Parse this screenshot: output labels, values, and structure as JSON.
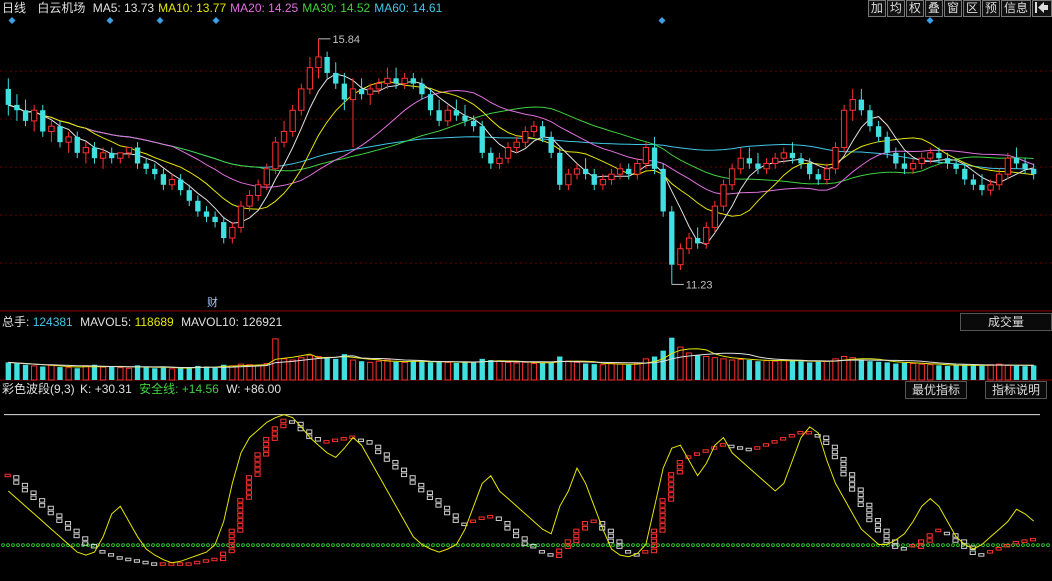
{
  "header": {
    "period": "日线",
    "stock_name": "白云机场",
    "ma": [
      {
        "label": "MA5:",
        "value": "13.73",
        "color": "#e0e0e0"
      },
      {
        "label": "MA10:",
        "value": "13.77",
        "color": "#e6e600"
      },
      {
        "label": "MA20:",
        "value": "14.25",
        "color": "#e070e0"
      },
      {
        "label": "MA30:",
        "value": "14.52",
        "color": "#40d040"
      },
      {
        "label": "MA60:",
        "value": "14.61",
        "color": "#40c8e8"
      }
    ]
  },
  "toolbar": {
    "buttons": [
      "加",
      "均",
      "权",
      "叠",
      "窗",
      "区",
      "预",
      "信息"
    ],
    "pin_icon": "pin-icon"
  },
  "price_panel": {
    "high_label": "15.84",
    "low_label": "11.23",
    "event_marker": "财"
  },
  "volume_panel": {
    "title": "总手:",
    "total": "124381",
    "mavol5_label": "MAVOL5:",
    "mavol5": "118689",
    "mavol10_label": "MAVOL10:",
    "mavol10": "126921",
    "dropdown_label": "成交量"
  },
  "indicator_panel": {
    "name": "彩色波段(9,3)",
    "k_label": "K:",
    "k_value": "+30.31",
    "safe_label": "安全线:",
    "safe_value": "+14.56",
    "w_label": "W:",
    "w_value": "+86.00",
    "best_button": "最优指标",
    "explain_button": "指标说明"
  },
  "colors": {
    "up": "#ff3030",
    "down": "#40e0e0",
    "ma5": "#e0e0e0",
    "ma10": "#e6e600",
    "ma20": "#e070e0",
    "ma30": "#40d040",
    "ma60": "#40c8e8",
    "grid": "#6a0000"
  },
  "chart_data": {
    "type": "line",
    "price_range": [
      10.9,
      16.1
    ],
    "candles": [
      [
        14.9,
        15.1,
        14.4,
        14.6
      ],
      [
        14.6,
        14.8,
        14.3,
        14.5
      ],
      [
        14.5,
        14.7,
        14.2,
        14.3
      ],
      [
        14.3,
        14.6,
        14.1,
        14.5
      ],
      [
        14.5,
        14.6,
        14.0,
        14.1
      ],
      [
        14.1,
        14.3,
        13.9,
        14.2
      ],
      [
        14.2,
        14.3,
        13.8,
        13.9
      ],
      [
        13.9,
        14.1,
        13.7,
        14.0
      ],
      [
        14.0,
        14.1,
        13.6,
        13.7
      ],
      [
        13.7,
        13.9,
        13.5,
        13.8
      ],
      [
        13.8,
        13.9,
        13.5,
        13.6
      ],
      [
        13.6,
        13.8,
        13.4,
        13.7
      ],
      [
        13.7,
        13.8,
        13.5,
        13.6
      ],
      [
        13.6,
        13.7,
        13.5,
        13.7
      ],
      [
        13.7,
        13.8,
        13.6,
        13.8
      ],
      [
        13.8,
        13.9,
        13.4,
        13.5
      ],
      [
        13.5,
        13.6,
        13.3,
        13.4
      ],
      [
        13.4,
        13.5,
        13.2,
        13.3
      ],
      [
        13.3,
        13.4,
        13.0,
        13.1
      ],
      [
        13.1,
        13.3,
        13.0,
        13.2
      ],
      [
        13.2,
        13.3,
        12.9,
        13.0
      ],
      [
        13.0,
        13.1,
        12.7,
        12.8
      ],
      [
        12.8,
        12.9,
        12.5,
        12.6
      ],
      [
        12.6,
        12.7,
        12.4,
        12.5
      ],
      [
        12.5,
        12.6,
        12.3,
        12.4
      ],
      [
        12.4,
        12.5,
        12.0,
        12.1
      ],
      [
        12.1,
        12.4,
        12.0,
        12.3
      ],
      [
        12.3,
        12.8,
        12.2,
        12.7
      ],
      [
        12.7,
        13.0,
        12.6,
        12.9
      ],
      [
        12.9,
        13.2,
        12.8,
        13.1
      ],
      [
        13.1,
        13.5,
        13.0,
        13.4
      ],
      [
        13.4,
        14.0,
        13.3,
        13.9
      ],
      [
        13.9,
        14.3,
        13.8,
        14.1
      ],
      [
        14.1,
        14.6,
        14.0,
        14.5
      ],
      [
        14.5,
        15.0,
        14.4,
        14.9
      ],
      [
        14.9,
        15.5,
        14.8,
        15.3
      ],
      [
        15.3,
        15.84,
        15.1,
        15.5
      ],
      [
        15.5,
        15.6,
        15.1,
        15.2
      ],
      [
        15.2,
        15.4,
        14.9,
        15.0
      ],
      [
        15.0,
        15.2,
        14.5,
        14.7
      ],
      [
        14.7,
        15.1,
        13.8,
        14.9
      ],
      [
        14.9,
        15.1,
        14.7,
        14.8
      ],
      [
        14.8,
        15.0,
        14.6,
        14.9
      ],
      [
        14.9,
        15.1,
        14.8,
        15.0
      ],
      [
        15.0,
        15.3,
        14.9,
        15.1
      ],
      [
        15.1,
        15.3,
        14.9,
        15.0
      ],
      [
        15.0,
        15.2,
        14.9,
        15.1
      ],
      [
        15.1,
        15.2,
        14.9,
        15.0
      ],
      [
        15.0,
        15.1,
        14.7,
        14.8
      ],
      [
        14.8,
        14.9,
        14.4,
        14.5
      ],
      [
        14.5,
        14.7,
        14.2,
        14.3
      ],
      [
        14.3,
        14.6,
        14.2,
        14.5
      ],
      [
        14.5,
        14.7,
        14.3,
        14.4
      ],
      [
        14.4,
        14.6,
        14.2,
        14.3
      ],
      [
        14.3,
        14.4,
        14.1,
        14.2
      ],
      [
        14.2,
        14.3,
        13.6,
        13.7
      ],
      [
        13.7,
        13.8,
        13.4,
        13.5
      ],
      [
        13.5,
        13.7,
        13.4,
        13.6
      ],
      [
        13.6,
        13.9,
        13.5,
        13.8
      ],
      [
        13.8,
        14.0,
        13.7,
        13.9
      ],
      [
        13.9,
        14.2,
        13.8,
        14.1
      ],
      [
        14.1,
        14.3,
        14.0,
        14.2
      ],
      [
        14.2,
        14.3,
        13.9,
        14.0
      ],
      [
        14.0,
        14.1,
        13.6,
        13.7
      ],
      [
        13.7,
        13.8,
        13.0,
        13.1
      ],
      [
        13.1,
        13.4,
        13.0,
        13.3
      ],
      [
        13.3,
        13.5,
        13.2,
        13.4
      ],
      [
        13.4,
        13.6,
        13.2,
        13.3
      ],
      [
        13.3,
        13.4,
        13.0,
        13.1
      ],
      [
        13.1,
        13.3,
        13.0,
        13.2
      ],
      [
        13.2,
        13.4,
        13.1,
        13.3
      ],
      [
        13.3,
        13.5,
        13.2,
        13.4
      ],
      [
        13.4,
        13.5,
        13.2,
        13.3
      ],
      [
        13.3,
        13.6,
        13.2,
        13.5
      ],
      [
        13.5,
        13.9,
        13.4,
        13.8
      ],
      [
        13.8,
        14.0,
        13.3,
        13.4
      ],
      [
        13.4,
        13.5,
        12.5,
        12.6
      ],
      [
        12.6,
        12.7,
        11.23,
        11.6
      ],
      [
        11.6,
        12.0,
        11.5,
        11.9
      ],
      [
        11.9,
        12.2,
        11.8,
        12.1
      ],
      [
        12.1,
        12.3,
        11.9,
        12.0
      ],
      [
        12.0,
        12.4,
        11.9,
        12.3
      ],
      [
        12.3,
        12.8,
        12.2,
        12.7
      ],
      [
        12.7,
        13.2,
        12.6,
        13.1
      ],
      [
        13.1,
        13.5,
        13.0,
        13.4
      ],
      [
        13.4,
        13.8,
        13.3,
        13.6
      ],
      [
        13.6,
        13.8,
        13.4,
        13.5
      ],
      [
        13.5,
        13.7,
        13.3,
        13.4
      ],
      [
        13.4,
        13.6,
        13.3,
        13.5
      ],
      [
        13.5,
        13.7,
        13.4,
        13.6
      ],
      [
        13.6,
        13.8,
        13.5,
        13.7
      ],
      [
        13.7,
        13.9,
        13.5,
        13.6
      ],
      [
        13.6,
        13.7,
        13.4,
        13.5
      ],
      [
        13.5,
        13.6,
        13.2,
        13.3
      ],
      [
        13.3,
        13.4,
        13.1,
        13.2
      ],
      [
        13.2,
        13.5,
        13.1,
        13.4
      ],
      [
        13.4,
        13.9,
        13.3,
        13.8
      ],
      [
        13.8,
        14.6,
        13.7,
        14.5
      ],
      [
        14.5,
        14.9,
        14.3,
        14.7
      ],
      [
        14.7,
        14.9,
        14.4,
        14.5
      ],
      [
        14.5,
        14.6,
        14.1,
        14.2
      ],
      [
        14.2,
        14.3,
        13.9,
        14.0
      ],
      [
        14.0,
        14.1,
        13.6,
        13.7
      ],
      [
        13.7,
        13.8,
        13.4,
        13.5
      ],
      [
        13.5,
        13.7,
        13.3,
        13.4
      ],
      [
        13.4,
        13.6,
        13.3,
        13.5
      ],
      [
        13.5,
        13.7,
        13.4,
        13.6
      ],
      [
        13.6,
        13.8,
        13.5,
        13.7
      ],
      [
        13.7,
        13.8,
        13.5,
        13.6
      ],
      [
        13.6,
        13.7,
        13.4,
        13.5
      ],
      [
        13.5,
        13.6,
        13.3,
        13.4
      ],
      [
        13.4,
        13.5,
        13.1,
        13.2
      ],
      [
        13.2,
        13.3,
        13.0,
        13.1
      ],
      [
        13.1,
        13.3,
        12.9,
        13.0
      ],
      [
        13.0,
        13.2,
        12.9,
        13.1
      ],
      [
        13.1,
        13.4,
        13.0,
        13.3
      ],
      [
        13.3,
        13.7,
        13.2,
        13.6
      ],
      [
        13.6,
        13.8,
        13.4,
        13.5
      ],
      [
        13.5,
        13.6,
        13.3,
        13.4
      ],
      [
        13.4,
        13.5,
        13.2,
        13.3
      ]
    ],
    "volume_range": [
      0,
      400000
    ],
    "volumes": [
      150000,
      140000,
      130000,
      120000,
      115000,
      125000,
      110000,
      105000,
      100000,
      120000,
      130000,
      110000,
      115000,
      105000,
      100000,
      125000,
      110000,
      100000,
      105000,
      95000,
      100000,
      110000,
      120000,
      115000,
      105000,
      130000,
      120000,
      135000,
      130000,
      125000,
      140000,
      350000,
      180000,
      170000,
      190000,
      210000,
      200000,
      190000,
      180000,
      220000,
      170000,
      160000,
      150000,
      160000,
      170000,
      155000,
      150000,
      160000,
      165000,
      150000,
      155000,
      150000,
      145000,
      155000,
      150000,
      180000,
      170000,
      160000,
      150000,
      145000,
      150000,
      140000,
      145000,
      150000,
      200000,
      160000,
      150000,
      140000,
      135000,
      130000,
      140000,
      135000,
      130000,
      140000,
      180000,
      200000,
      250000,
      360000,
      280000,
      230000,
      210000,
      200000,
      190000,
      180000,
      170000,
      175000,
      170000,
      160000,
      165000,
      160000,
      170000,
      165000,
      160000,
      150000,
      155000,
      160000,
      180000,
      200000,
      190000,
      175000,
      160000,
      155000,
      150000,
      140000,
      145000,
      140000,
      135000,
      130000,
      125000,
      120000,
      125000,
      130000,
      125000,
      120000,
      130000,
      135000,
      125000,
      120000,
      118000,
      124381
    ],
    "indicator_range": [
      -5,
      105
    ],
    "k_line": [
      50,
      45,
      40,
      35,
      30,
      25,
      20,
      15,
      10,
      8,
      10,
      20,
      35,
      40,
      30,
      20,
      12,
      8,
      5,
      3,
      4,
      6,
      8,
      10,
      15,
      30,
      55,
      75,
      85,
      90,
      95,
      98,
      100,
      98,
      92,
      85,
      80,
      75,
      72,
      78,
      85,
      80,
      70,
      60,
      50,
      40,
      30,
      20,
      15,
      12,
      10,
      12,
      15,
      25,
      40,
      55,
      60,
      50,
      45,
      40,
      35,
      30,
      25,
      22,
      40,
      50,
      65,
      55,
      40,
      25,
      12,
      8,
      7,
      9,
      15,
      40,
      65,
      78,
      80,
      70,
      60,
      68,
      80,
      85,
      75,
      70,
      65,
      60,
      55,
      50,
      55,
      70,
      85,
      92,
      88,
      70,
      55,
      45,
      35,
      25,
      20,
      15,
      15,
      18,
      22,
      30,
      40,
      45,
      40,
      30,
      20,
      15,
      12,
      15,
      20,
      25,
      30,
      38,
      35,
      30.31
    ],
    "w_line": [
      60,
      55,
      50,
      45,
      40,
      35,
      30,
      25,
      20,
      15,
      12,
      10,
      8,
      6,
      5,
      4,
      3,
      2,
      2,
      2,
      2,
      2,
      3,
      4,
      5,
      10,
      25,
      45,
      60,
      75,
      85,
      92,
      97,
      95,
      90,
      85,
      82,
      82,
      83,
      84,
      85,
      83,
      80,
      75,
      70,
      65,
      60,
      55,
      50,
      45,
      40,
      35,
      30,
      28,
      30,
      32,
      33,
      30,
      25,
      20,
      15,
      12,
      10,
      8,
      12,
      18,
      25,
      30,
      30,
      25,
      18,
      12,
      10,
      8,
      10,
      25,
      45,
      62,
      70,
      72,
      74,
      76,
      78,
      80,
      79,
      78,
      77,
      78,
      80,
      82,
      84,
      86,
      88,
      88,
      86,
      80,
      72,
      62,
      52,
      42,
      32,
      25,
      18,
      14,
      12,
      14,
      18,
      22,
      24,
      22,
      18,
      14,
      10,
      8,
      10,
      12,
      14,
      16,
      17,
      18
    ],
    "safe_line": 14.56
  }
}
